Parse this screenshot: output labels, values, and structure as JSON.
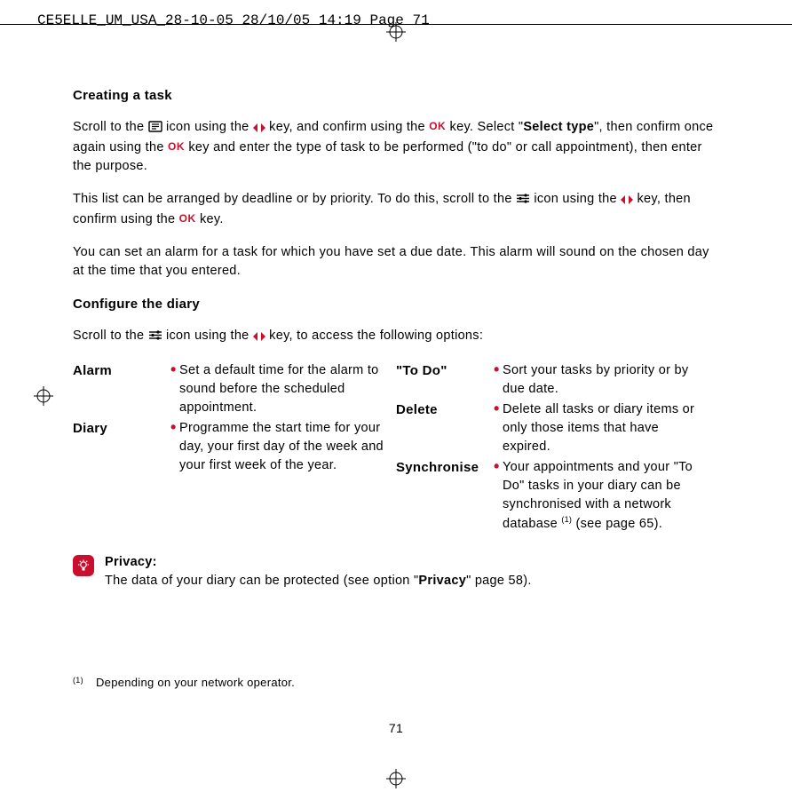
{
  "header": "CE5ELLE_UM_USA_28-10-05  28/10/05  14:19  Page 71",
  "h_task": "Creating a task",
  "p_task_1a": "Scroll to the ",
  "p_task_1b": " icon using the ",
  "p_task_1c": " key, and confirm using the ",
  "p_task_1d": " key. Select \"",
  "p_task_1e": "Select type",
  "p_task_1f": "\", then confirm once again using the ",
  "p_task_1g": " key and enter the type of task to be performed (\"to do\" or call appointment), then enter the purpose.",
  "p_task_2a": "This list can be arranged by deadline or by priority. To do this, scroll to the ",
  "p_task_2b": " icon using the ",
  "p_task_2c": " key, then confirm using the ",
  "p_task_2d": " key.",
  "p_task_3": "You can set an alarm for a task for which you have set a due date. This alarm will sound on the chosen day at the time that you entered.",
  "h_diary": "Configure the diary",
  "p_diary_a": "Scroll to the ",
  "p_diary_b": " icon using the ",
  "p_diary_c": " key, to access the following options:",
  "ok_label": "OK",
  "options_left": [
    {
      "label": "Alarm",
      "text": "Set a default time for the alarm to sound before the scheduled appointment."
    },
    {
      "label": "Diary",
      "text": "Programme the start time for your day, your first day of the week and your first week of the year."
    }
  ],
  "options_right": [
    {
      "label": "\"To Do\"",
      "text": "Sort your tasks by priority or by due date."
    },
    {
      "label": "Delete",
      "text": "Delete all tasks or diary items or only those items that have expired."
    },
    {
      "label": "Synchronise",
      "text_a": "Your appointments and your \"To Do\" tasks in your diary can be synchronised with a network database ",
      "sup": "(1)",
      "text_b": " (see page 65)."
    }
  ],
  "privacy_label": "Privacy",
  "privacy_text_a": "The data of your diary can be protected (see option \"",
  "privacy_bold": "Privacy",
  "privacy_text_b": "\" page 58).",
  "footnote_mark": "(1)",
  "footnote_text": "Depending on your network operator.",
  "page_number": "71"
}
